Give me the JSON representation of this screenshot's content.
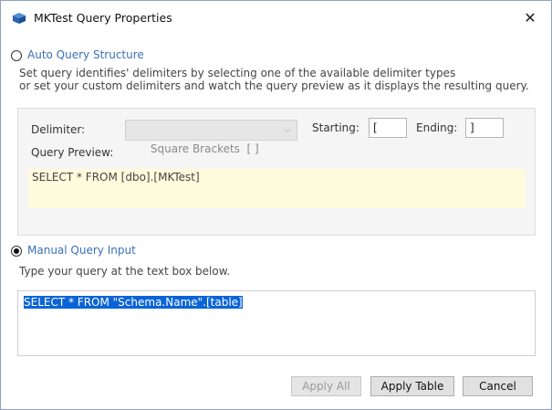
{
  "window": {
    "title": "MKTest Query Properties"
  },
  "auto": {
    "label": "Auto Query Structure",
    "desc_line1": "Set query identifies' delimiters by selecting one of the available delimiter types",
    "desc_line2": "or set your custom delimiters and watch the query preview as it displays the resulting query.",
    "delimiter_label": "Delimiter:",
    "delimiter_value": "Square Brackets  [ ]",
    "starting_label": "Starting:",
    "starting_value": "[",
    "ending_label": "Ending:",
    "ending_value": "]",
    "preview_label": "Query Preview:",
    "preview_text": "SELECT * FROM [dbo].[MKTest]"
  },
  "manual": {
    "label": "Manual Query Input",
    "desc": "Type your query at the text box below.",
    "query_text": "SELECT * FROM \"Schema.Name\".[table]"
  },
  "buttons": {
    "apply_all": "Apply All",
    "apply_table": "Apply Table",
    "cancel": "Cancel"
  }
}
